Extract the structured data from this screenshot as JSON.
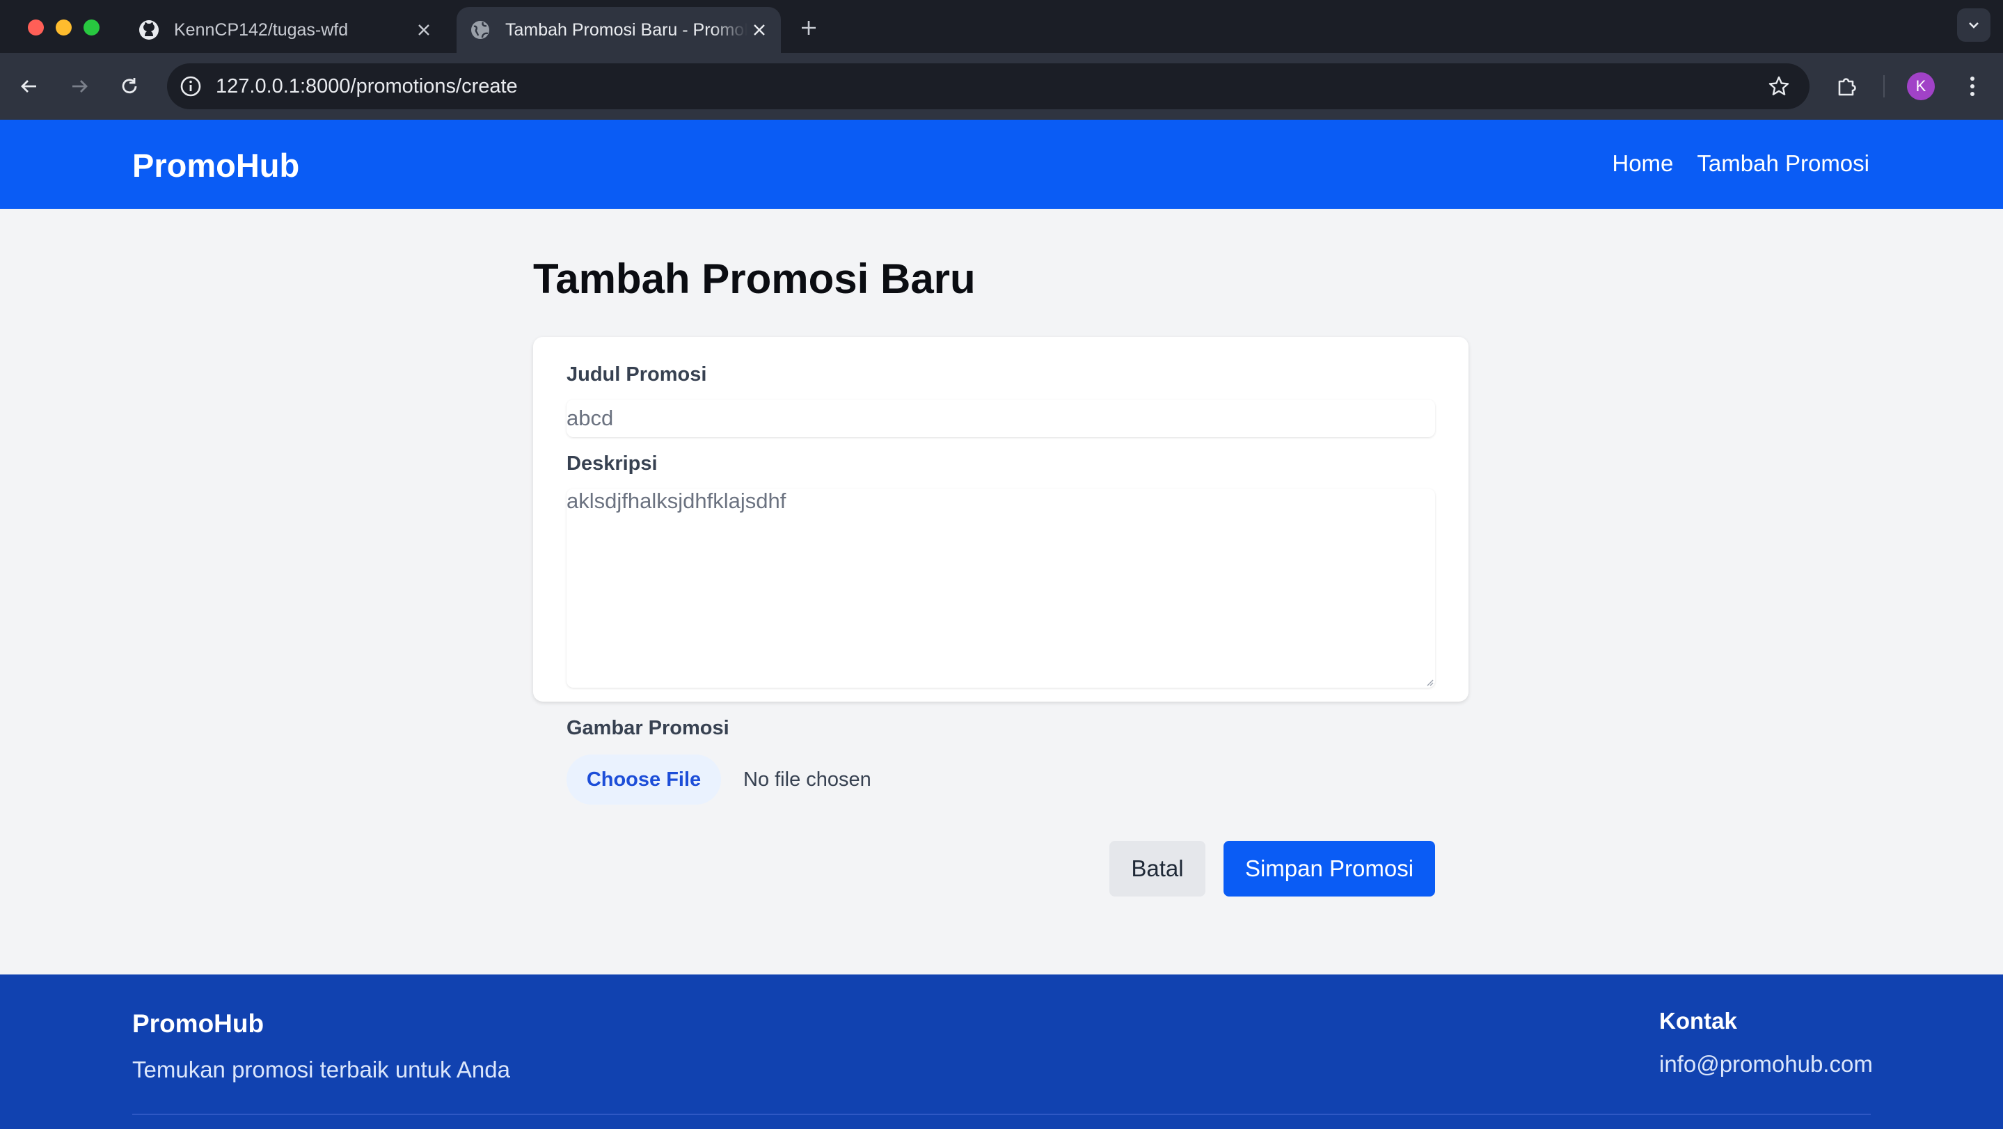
{
  "browser": {
    "tabs": [
      {
        "title": "KennCP142/tugas-wfd",
        "icon": "github-icon",
        "active": false
      },
      {
        "title": "Tambah Promosi Baru - PromoHub",
        "icon": "globe-icon",
        "active": true
      }
    ],
    "url": "127.0.0.1:8000/promotions/create",
    "profile_initial": "K"
  },
  "site": {
    "brand": "PromoHub",
    "nav": [
      "Home",
      "Tambah Promosi"
    ]
  },
  "form": {
    "heading": "Tambah Promosi Baru",
    "title_label": "Judul Promosi",
    "title_value": "abcd",
    "description_label": "Deskripsi",
    "description_value": "aklsdjfhalksjdhfklajsdhf",
    "image_label": "Gambar Promosi",
    "choose_file": "Choose File",
    "no_file": "No file chosen",
    "cancel": "Batal",
    "save": "Simpan Promosi"
  },
  "footer": {
    "brand": "PromoHub",
    "tagline": "Temukan promosi terbaik untuk Anda",
    "contact_heading": "Kontak",
    "email": "info@promohub.com"
  },
  "colors": {
    "primary": "#0a5cf5",
    "footer": "#1142b0",
    "background": "#f3f4f6"
  }
}
